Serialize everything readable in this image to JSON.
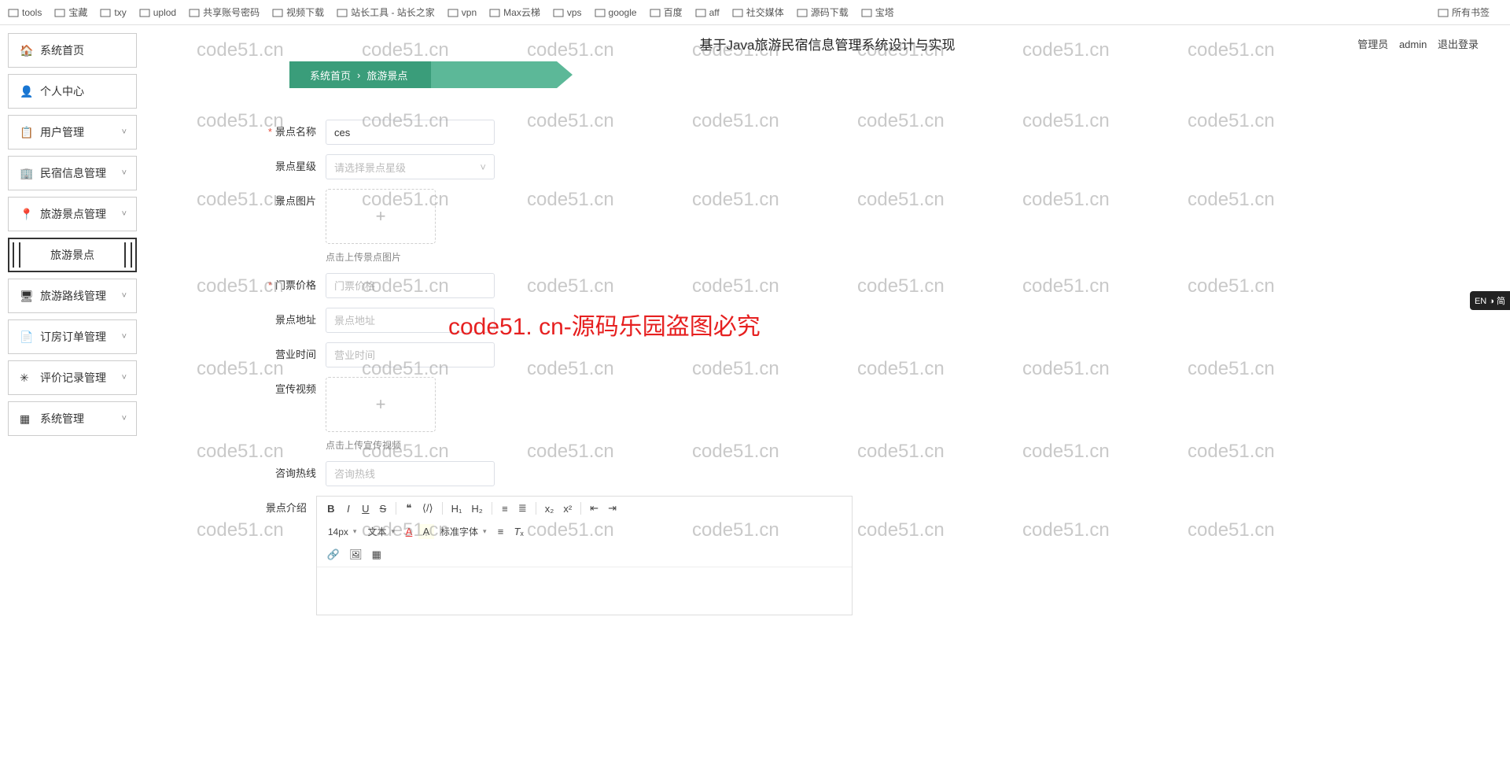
{
  "bookmarks": {
    "items": [
      "tools",
      "宝藏",
      "txy",
      "uplod",
      "共享账号密码",
      "视频下载",
      "站长工具 - 站长之家",
      "vpn",
      "Max云梯",
      "vps",
      "google",
      "百度",
      "aff",
      "社交媒体",
      "源码下载",
      "宝塔"
    ],
    "right": "所有书签"
  },
  "header": {
    "title": "基于Java旅游民宿信息管理系统设计与实现",
    "role": "管理员",
    "user": "admin",
    "logout": "退出登录"
  },
  "breadcrumb": {
    "root": "系统首页",
    "current": "旅游景点",
    "sep": "›"
  },
  "sidebar": {
    "items": [
      {
        "icon": "🏠",
        "label": "系统首页",
        "arrow": ""
      },
      {
        "icon": "👤",
        "label": "个人中心",
        "arrow": ""
      },
      {
        "icon": "📋",
        "label": "用户管理",
        "arrow": "˅"
      },
      {
        "icon": "🏢",
        "label": "民宿信息管理",
        "arrow": "˅"
      },
      {
        "icon": "📍",
        "label": "旅游景点管理",
        "arrow": "˅"
      },
      {
        "icon": "",
        "label": "旅游景点",
        "arrow": "",
        "sub": true
      },
      {
        "icon": "🖥",
        "label": "旅游路线管理",
        "arrow": "˅"
      },
      {
        "icon": "📄",
        "label": "订房订单管理",
        "arrow": "˅"
      },
      {
        "icon": "✳",
        "label": "评价记录管理",
        "arrow": "˅"
      },
      {
        "icon": "▦",
        "label": "系统管理",
        "arrow": "˅"
      }
    ]
  },
  "form": {
    "name": {
      "label": "景点名称",
      "value": "ces",
      "req": true
    },
    "level": {
      "label": "景点星级",
      "placeholder": "请选择景点星级"
    },
    "image": {
      "label": "景点图片",
      "hint": "点击上传景点图片"
    },
    "price": {
      "label": "门票价格",
      "placeholder": "门票价格",
      "req": true
    },
    "address": {
      "label": "景点地址",
      "placeholder": "景点地址"
    },
    "hours": {
      "label": "营业时间",
      "placeholder": "营业时间"
    },
    "video": {
      "label": "宣传视频",
      "hint": "点击上传宣传视频"
    },
    "phone": {
      "label": "咨询热线",
      "placeholder": "咨询热线"
    },
    "intro": {
      "label": "景点介绍"
    }
  },
  "editor": {
    "fontsize": "14px",
    "para": "文本",
    "fontfamily": "标准字体"
  },
  "watermark_text": "code51.cn",
  "big_watermark": "code51. cn-源码乐园盗图必究",
  "ime": "EN ◑ 简"
}
